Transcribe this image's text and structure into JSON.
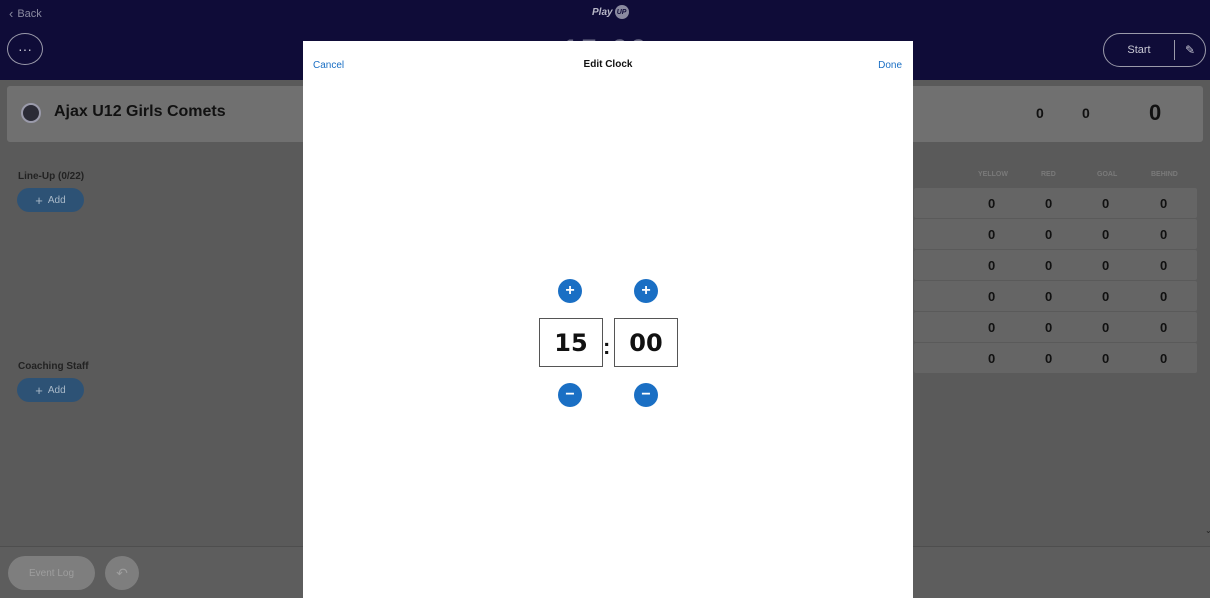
{
  "header": {
    "back_label": "Back",
    "logo_text": "Play",
    "logo_badge": "UP",
    "more_label": "···",
    "clock_display": "15:00",
    "start_label": "Start"
  },
  "team": {
    "name": "Ajax U12 Girls Comets",
    "score_a": "0",
    "score_b": "0",
    "score_total": "0"
  },
  "lineup": {
    "title": "Line-Up (0/22)",
    "add_label": "Add"
  },
  "coaching": {
    "title": "Coaching Staff",
    "add_label": "Add"
  },
  "stats": {
    "headers": [
      "YELLOW",
      "RED",
      "GOAL",
      "BEHIND"
    ],
    "rows": [
      [
        "0",
        "0",
        "0",
        "0"
      ],
      [
        "0",
        "0",
        "0",
        "0"
      ],
      [
        "0",
        "0",
        "0",
        "0"
      ],
      [
        "0",
        "0",
        "0",
        "0"
      ],
      [
        "0",
        "0",
        "0",
        "0"
      ],
      [
        "0",
        "0",
        "0",
        "0"
      ]
    ]
  },
  "bottom": {
    "event_log_label": "Event Log"
  },
  "modal": {
    "cancel_label": "Cancel",
    "title": "Edit Clock",
    "done_label": "Done",
    "minutes": "15",
    "seconds": "00",
    "separator": ":"
  }
}
